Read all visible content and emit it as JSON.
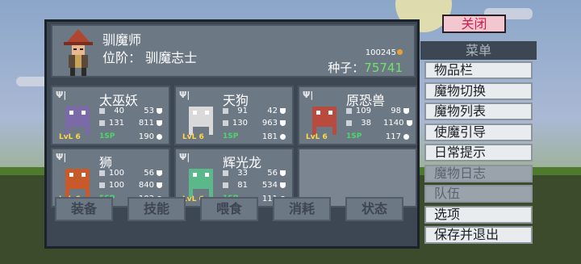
{
  "header": {
    "name": "驯魔师",
    "rank_label": "位阶：",
    "rank_value": "驯魔志士",
    "gold": "100245",
    "seeds_label": "种子：",
    "seeds_value": "75741"
  },
  "monsters": [
    {
      "name": "太巫妖",
      "atk": "40",
      "def": "53",
      "mag": "131",
      "mdef": "811",
      "lv": "LvL 6",
      "sp": "1SP",
      "hp": "190",
      "color": "#7c6aa8"
    },
    {
      "name": "天狗",
      "atk": "91",
      "def": "42",
      "mag": "130",
      "mdef": "963",
      "lv": "LvL 6",
      "sp": "1SP",
      "hp": "181",
      "color": "#d9d9d9"
    },
    {
      "name": "原恐兽",
      "atk": "109",
      "def": "98",
      "mag": "38",
      "mdef": "1140",
      "lv": "LvL 6",
      "sp": "1SP",
      "hp": "117",
      "color": "#b84a3e"
    },
    {
      "name": "狮",
      "atk": "100",
      "def": "56",
      "mag": "100",
      "mdef": "840",
      "lv": "LvL 6",
      "sp": "5SP",
      "hp": "103",
      "color": "#c85a2a"
    },
    {
      "name": "辉光龙",
      "atk": "33",
      "def": "56",
      "mag": "81",
      "mdef": "534",
      "lv": "LvL 6",
      "sp": "1SP",
      "hp": "111",
      "color": "#5ab88a"
    }
  ],
  "tabs": [
    "装备",
    "技能",
    "喂食",
    "消耗",
    "状态"
  ],
  "close_label": "关闭",
  "menu_title": "菜单",
  "menu_items": [
    {
      "label": "物品栏",
      "enabled": true
    },
    {
      "label": "魔物切换",
      "enabled": true
    },
    {
      "label": "魔物列表",
      "enabled": true
    },
    {
      "label": "使魔引导",
      "enabled": true
    },
    {
      "label": "日常提示",
      "enabled": true
    },
    {
      "label": "魔物日志",
      "enabled": false
    },
    {
      "label": "队伍",
      "enabled": false
    },
    {
      "label": "选项",
      "enabled": true
    },
    {
      "label": "保存并退出",
      "enabled": true
    }
  ]
}
